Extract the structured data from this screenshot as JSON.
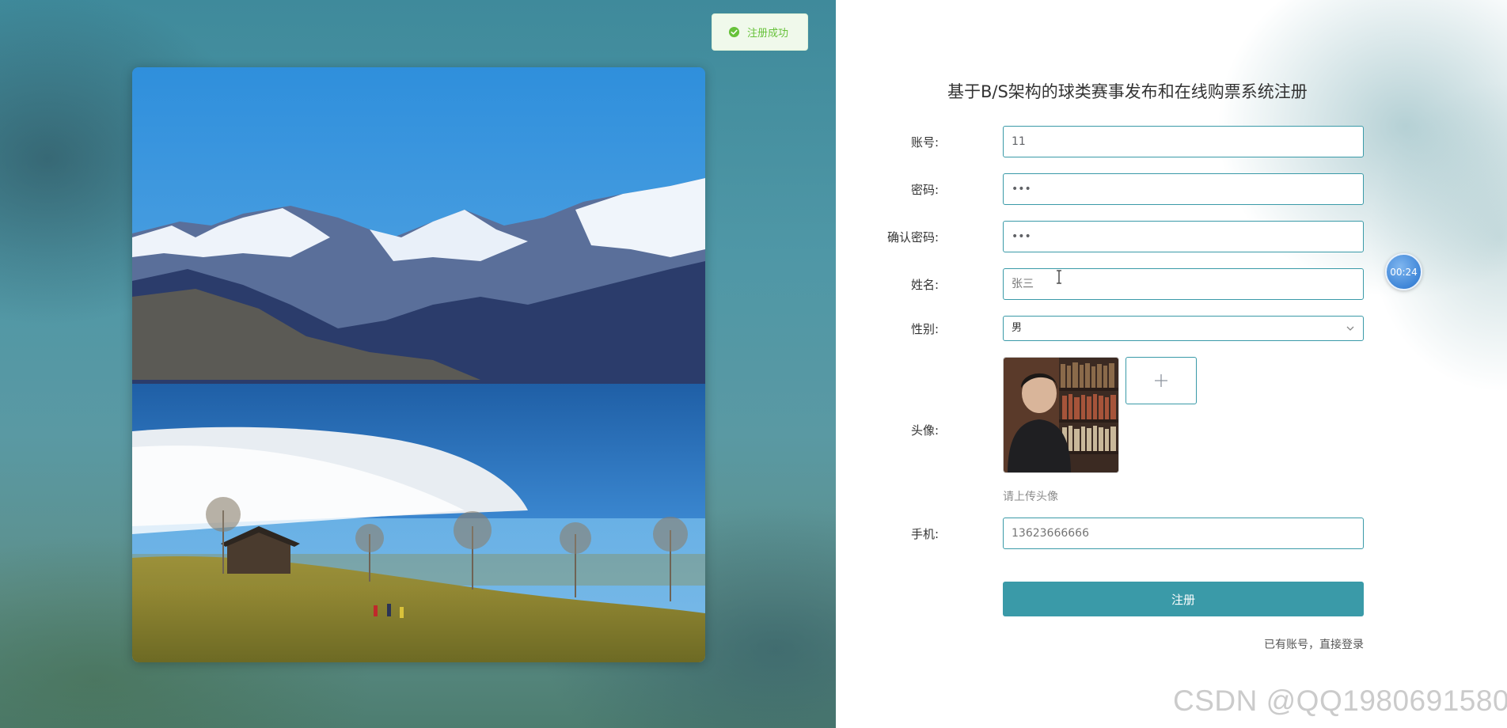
{
  "toast": {
    "icon": "check-circle-icon",
    "text": "注册成功"
  },
  "form": {
    "title": "基于B/S架构的球类赛事发布和在线购票系统注册",
    "account": {
      "label": "账号:",
      "value": "11"
    },
    "password": {
      "label": "密码:",
      "value": "•••"
    },
    "confirm_password": {
      "label": "确认密码:",
      "value": "•••"
    },
    "name": {
      "label": "姓名:",
      "placeholder": "张三"
    },
    "gender": {
      "label": "性别:",
      "selected": "男",
      "icon": "chevron-down-icon"
    },
    "avatar": {
      "label": "头像:",
      "upload_icon": "plus-icon",
      "hint": "请上传头像"
    },
    "phone": {
      "label": "手机:",
      "placeholder": "13623666666"
    },
    "submit_label": "注册",
    "login_link": "已有账号，直接登录"
  },
  "timer": "00:24",
  "watermark": "CSDN @QQ1980691580",
  "colors": {
    "primary": "#3a9aa8",
    "success": "#67c23a",
    "toast_bg": "#f0f9eb"
  }
}
